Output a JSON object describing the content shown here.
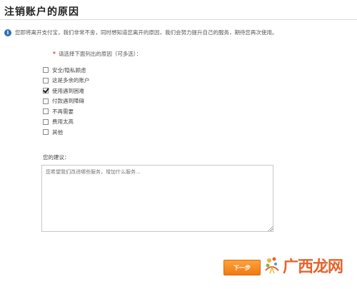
{
  "page": {
    "title": "注销账户的原因",
    "notice": "您即将离开支付宝，我们非常不舍，同时想知道您离开的原因，我们会努力提升自己的服务，期待您再次使用。"
  },
  "reasons": {
    "required_mark": "*",
    "prompt": "请选择下面列出的原因（可多选）：",
    "items": [
      {
        "label": "安全/隐私顾虑",
        "checked": false
      },
      {
        "label": "这是多余的账户",
        "checked": false
      },
      {
        "label": "使用遇到困难",
        "checked": true
      },
      {
        "label": "付款遇到障碍",
        "checked": false
      },
      {
        "label": "不再需要",
        "checked": false
      },
      {
        "label": "费用太高",
        "checked": false
      },
      {
        "label": "其他",
        "checked": false
      }
    ]
  },
  "advice": {
    "label": "您的建议：",
    "placeholder": "您希望我们改进哪些服务，增加什么服务..."
  },
  "actions": {
    "next_label": "下一步"
  },
  "watermark": {
    "text": "广西龙网"
  },
  "colors": {
    "accent": "#ef7a12",
    "required": "#e4393c",
    "info": "#2f6fb4",
    "watermark": "#e8622a"
  }
}
